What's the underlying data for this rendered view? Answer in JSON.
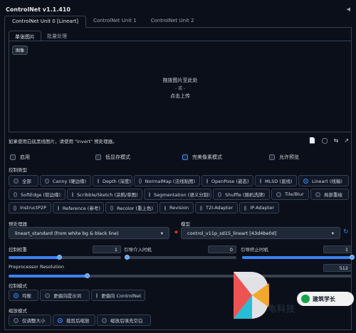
{
  "header": {
    "title": "ControlNet v1.1.410",
    "collapse_icon": "◀"
  },
  "tabs": [
    {
      "label": "ControlNet Unit 0 [Lineart]",
      "active": true
    },
    {
      "label": "ControlNet Unit 1",
      "active": false
    },
    {
      "label": "ControlNet Unit 2",
      "active": false
    }
  ],
  "subtabs": [
    {
      "label": "单张图片",
      "active": true
    },
    {
      "label": "批量处理",
      "active": false
    }
  ],
  "dropzone": {
    "image_label": "图像",
    "line1": "拖放图片至此处",
    "line2": "- 或 -",
    "line3": "点击上传"
  },
  "note": "如果使用白底黑线图片，请使用 \"invert\" 预处理器。",
  "toolbar_icons": [
    "new-canvas-icon",
    "camera-icon",
    "swap-icon",
    "send-dimensions-icon"
  ],
  "checkboxes": [
    {
      "label": "启用",
      "checked": false
    },
    {
      "label": "低显存模式",
      "checked": false
    },
    {
      "label": "完美像素模式",
      "checked": false
    },
    {
      "label": "允许预览",
      "checked": false
    }
  ],
  "control_type": {
    "label": "控制类型",
    "options": [
      {
        "label": "全部",
        "selected": false
      },
      {
        "label": "Canny (硬边缘)",
        "selected": false
      },
      {
        "label": "Depth (深度)",
        "selected": false
      },
      {
        "label": "NormalMap (法线贴图)",
        "selected": false
      },
      {
        "label": "OpenPose (姿态)",
        "selected": false
      },
      {
        "label": "MLSD (直线)",
        "selected": false
      },
      {
        "label": "Lineart (线稿)",
        "selected": true
      },
      {
        "label": "SoftEdge (软边缘)",
        "selected": false
      },
      {
        "label": "Scribble/Sketch (涂鸦/草图)",
        "selected": false
      },
      {
        "label": "Segmentation (语义分割)",
        "selected": false
      },
      {
        "label": "Shuffle (随机洗牌)",
        "selected": false
      },
      {
        "label": "Tile/Blur",
        "selected": false
      },
      {
        "label": "局部重绘",
        "selected": false
      },
      {
        "label": "InstructP2P",
        "selected": false
      },
      {
        "label": "Reference (参考)",
        "selected": false
      },
      {
        "label": "Recolor (重上色)",
        "selected": false
      },
      {
        "label": "Revision",
        "selected": false
      },
      {
        "label": "T2I-Adapter",
        "selected": false
      },
      {
        "label": "IP-Adapter",
        "selected": false
      }
    ]
  },
  "preprocessor": {
    "label": "预处理器",
    "value": "lineart_standard (from white bg & black line)"
  },
  "model": {
    "label": "模型",
    "value": "control_v11p_sd15_lineart [43d4be0d]"
  },
  "sliders": {
    "weight": {
      "label": "控制权重",
      "value": "1",
      "fraction": 0.45
    },
    "start": {
      "label": "引导介入时机",
      "value": "0",
      "fraction": 0.0
    },
    "end": {
      "label": "引导终止时机",
      "value": "1",
      "fraction": 1.0
    },
    "resolution": {
      "label": "Preprocessor Resolution",
      "value": "512",
      "fraction": 0.23
    }
  },
  "control_mode": {
    "label": "控制模式",
    "options": [
      {
        "label": "均衡",
        "selected": true
      },
      {
        "label": "更偏向提示词",
        "selected": false
      },
      {
        "label": "更偏向 ControlNet",
        "selected": false
      }
    ]
  },
  "resize_mode": {
    "label": "缩放模式",
    "options": [
      {
        "label": "仅调整大小",
        "selected": false
      },
      {
        "label": "裁剪后缩放",
        "selected": true
      },
      {
        "label": "缩放后填充空白",
        "selected": false
      }
    ]
  },
  "watermark": {
    "text": "建筑学长",
    "behind_text": "电科技"
  },
  "colors": {
    "accent": "#3b82f6",
    "background": "#0b0f19",
    "border": "#374151"
  }
}
